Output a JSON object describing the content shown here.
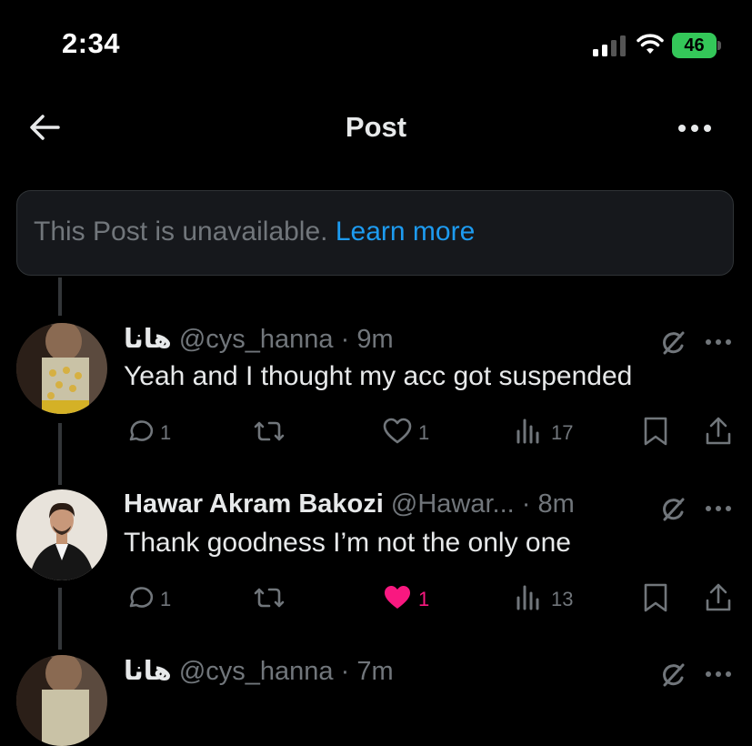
{
  "status_bar": {
    "time": "2:34",
    "battery": "46"
  },
  "nav": {
    "title": "Post"
  },
  "unavailable": {
    "text": "This Post is unavailable.",
    "link": "Learn more"
  },
  "tweets": [
    {
      "name": "هانا",
      "handle": "@cys_hanna",
      "time": "9m",
      "text": "Yeah and I thought my acc got suspended",
      "replies": "1",
      "reposts": "",
      "likes": "1",
      "views": "17",
      "liked": false
    },
    {
      "name": "Hawar Akram Bakozi",
      "handle": "@Hawar...",
      "time": "8m",
      "text": "Thank goodness I’m not the only one",
      "replies": "1",
      "reposts": "",
      "likes": "1",
      "views": "13",
      "liked": true
    },
    {
      "name": "هانا",
      "handle": "@cys_hanna",
      "time": "7m"
    }
  ],
  "colors": {
    "accent": "#1d9bf0",
    "like": "#f91880",
    "battery": "#34c759",
    "muted": "#71767b"
  }
}
